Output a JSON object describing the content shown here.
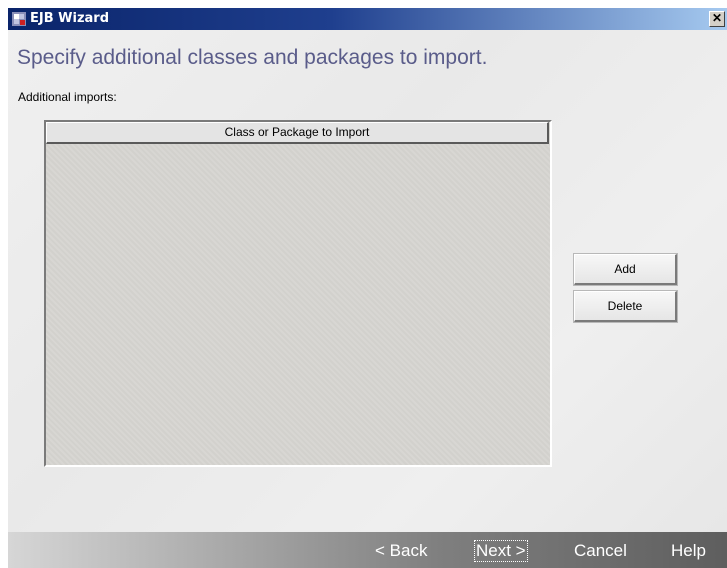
{
  "window": {
    "title": "EJB Wizard",
    "close_label": "✕"
  },
  "page": {
    "heading": "Specify additional classes and packages to import.",
    "imports_label": "Additional imports:"
  },
  "table": {
    "columns": [
      "Class or Package to Import"
    ],
    "rows": []
  },
  "side_buttons": {
    "add": "Add",
    "delete": "Delete"
  },
  "footer": {
    "back": "< Back",
    "next": "Next >",
    "cancel": "Cancel",
    "help": "Help"
  },
  "colors": {
    "title_bar": "#0a246a",
    "heading": "#5a5c8a"
  }
}
